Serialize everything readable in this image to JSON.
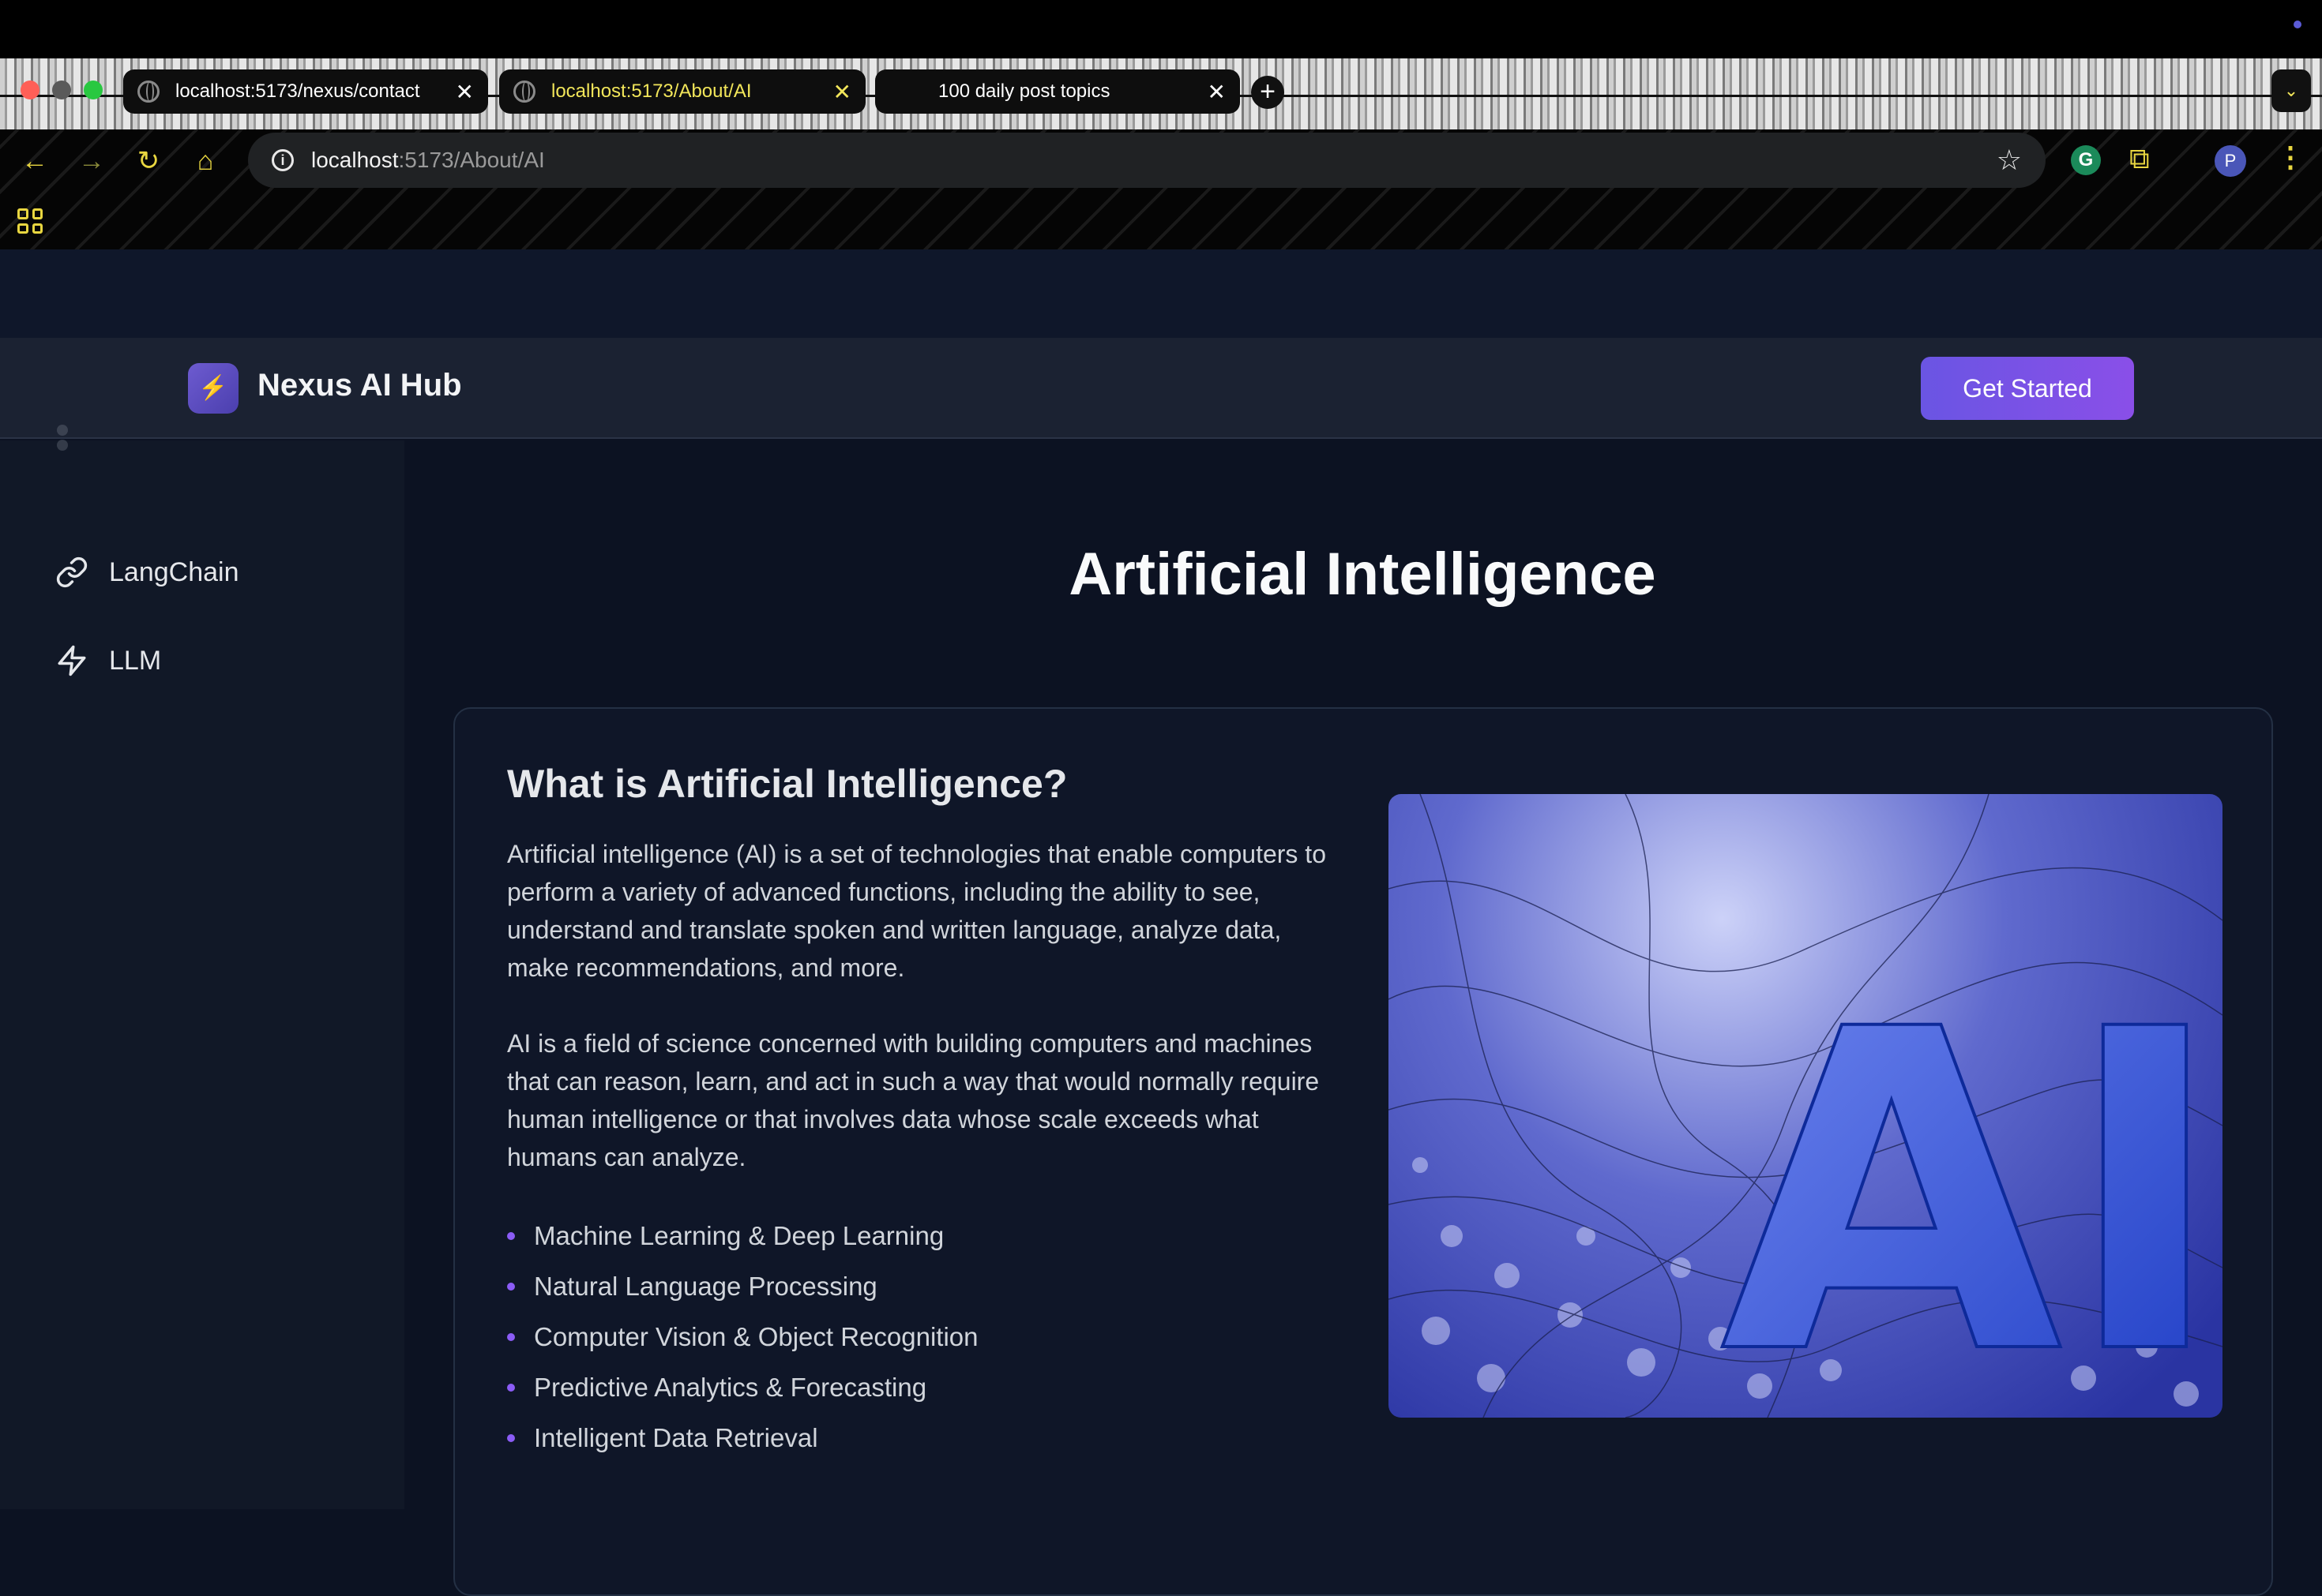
{
  "browser": {
    "tabs": [
      {
        "title": "localhost:5173/nexus/contact",
        "active": false
      },
      {
        "title": "localhost:5173/About/AI",
        "active": true
      },
      {
        "title": "100 daily post topics",
        "active": false
      }
    ],
    "url_host": "localhost",
    "url_path": ":5173/About/AI",
    "profile_initial": "P",
    "extension_letter": "G",
    "icons": [
      "back-icon",
      "forward-icon",
      "reload-icon",
      "home-icon",
      "info-icon",
      "star-icon",
      "puzzle-icon",
      "apps-grid-icon"
    ]
  },
  "app": {
    "brand": "Nexus AI Hub",
    "logo_glyph": "⚡",
    "cta_label": "Get Started",
    "accent": "#7c5ce6"
  },
  "sidebar": {
    "items": [
      {
        "label": "LangChain",
        "icon": "link-icon"
      },
      {
        "label": "LLM",
        "icon": "zap-icon"
      }
    ]
  },
  "main": {
    "title": "Artificial Intelligence",
    "card": {
      "heading": "What is Artificial Intelligence?",
      "paragraph1": "Artificial intelligence (AI) is a set of technologies that enable computers to perform a variety of advanced functions, including the ability to see, understand and translate spoken and written language, analyze data, make recommendations, and more.",
      "paragraph2": "AI is a field of science concerned with building computers and machines that can reason, learn, and act in such a way that would normally require human intelligence or that involves data whose scale exceeds what humans can analyze.",
      "bullets": [
        "Machine Learning & Deep Learning",
        "Natural Language Processing",
        "Computer Vision & Object Recognition",
        "Predictive Analytics & Forecasting",
        "Intelligent Data Retrieval"
      ],
      "image_text": "AI"
    }
  }
}
